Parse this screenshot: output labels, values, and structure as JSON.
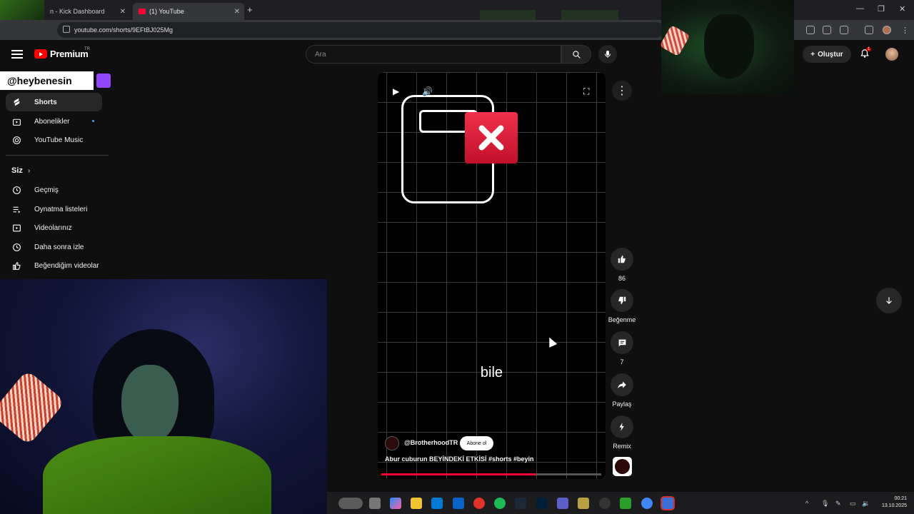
{
  "browser": {
    "tabs": [
      {
        "title": "n - Kick Dashboard",
        "active": false
      },
      {
        "title": "(1) YouTube",
        "active": true
      }
    ],
    "url": "youtube.com/shorts/9EFtBJ025Mg",
    "window_controls": {
      "minimize": "—",
      "maximize": "❐",
      "close": "✕"
    }
  },
  "header": {
    "brand": "Premium",
    "region": "TR",
    "search_placeholder": "Ara",
    "create_label": "Oluştur",
    "notifications_count": "1"
  },
  "overlay": {
    "streamer_handle": "@heybenesin"
  },
  "sidebar": {
    "items": [
      {
        "label": "Shorts",
        "icon": "shorts-icon",
        "active": true
      },
      {
        "label": "Abonelikler",
        "icon": "subscriptions-icon"
      },
      {
        "label": "YouTube Music",
        "icon": "music-icon"
      }
    ],
    "you_section_title": "Siz",
    "you_items": [
      {
        "label": "Geçmiş",
        "icon": "history-icon"
      },
      {
        "label": "Oynatma listeleri",
        "icon": "playlists-icon"
      },
      {
        "label": "Videolarınız",
        "icon": "your-videos-icon"
      },
      {
        "label": "Daha sonra izle",
        "icon": "watch-later-icon"
      },
      {
        "label": "Beğendiğim videolar",
        "icon": "liked-icon"
      }
    ]
  },
  "short": {
    "caption": "bile",
    "channel": "@BrotherhoodTR",
    "subscribe_label": "Abone ol",
    "title": "Abur cuburun BEYİNDEKİ ETKİSİ",
    "hashtags": "#shorts #beyin",
    "progress": 0.7
  },
  "actions": {
    "likes": "86",
    "dislike_label": "Beğenme",
    "comments": "7",
    "share_label": "Paylaş",
    "remix_label": "Remix"
  },
  "taskbar": {
    "time": "00:21",
    "date": "13.10.2025"
  },
  "colors": {
    "accent": "#ff0033",
    "twitch": "#9146ff",
    "background": "#0f0f0f"
  }
}
